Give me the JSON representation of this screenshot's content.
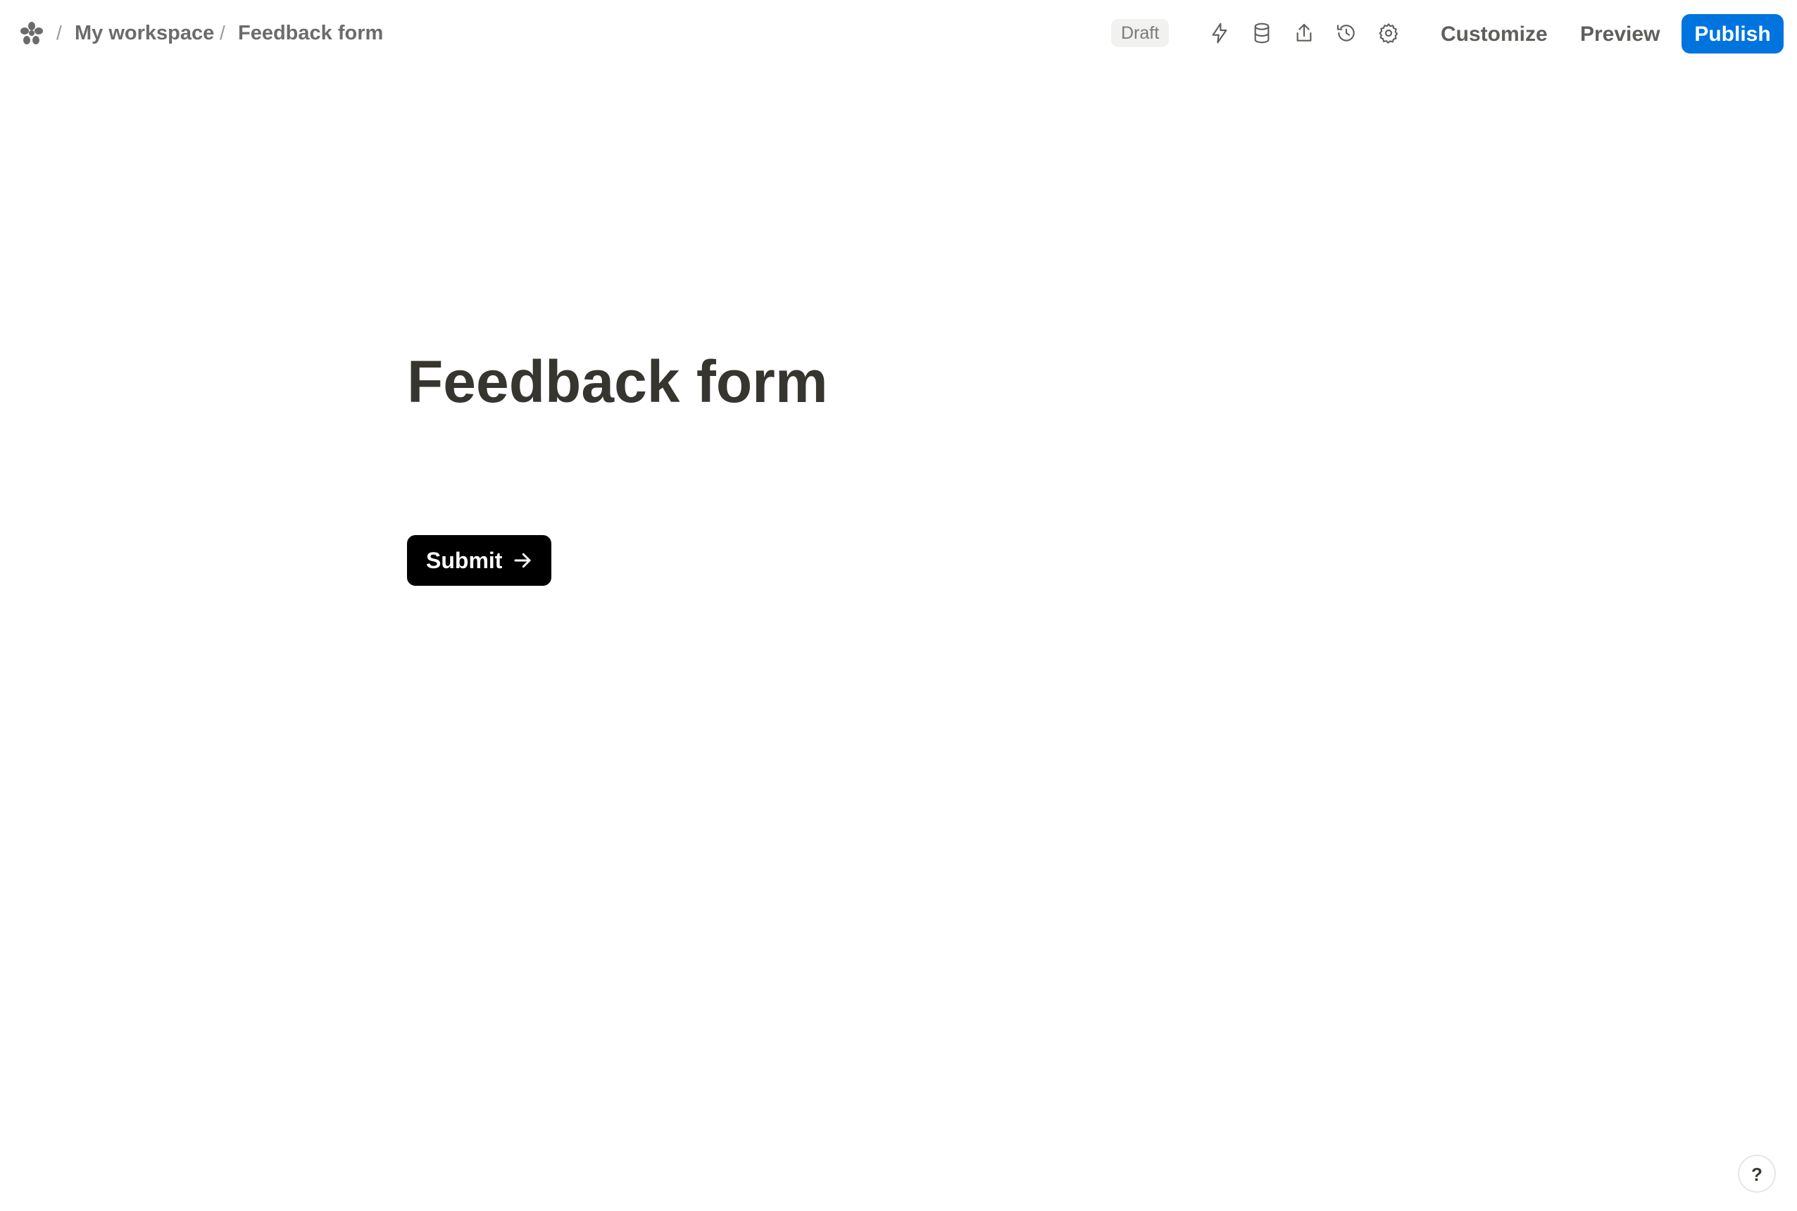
{
  "header": {
    "breadcrumb": [
      {
        "label": "My workspace"
      },
      {
        "label": "Feedback form"
      }
    ],
    "separator": "/",
    "status_badge": "Draft",
    "icons": [
      "lightning-icon",
      "database-icon",
      "share-icon",
      "history-icon",
      "gear-icon"
    ],
    "customize_label": "Customize",
    "preview_label": "Preview",
    "publish_label": "Publish"
  },
  "form": {
    "title": "Feedback form",
    "submit_label": "Submit"
  },
  "help": {
    "label": "?"
  },
  "colors": {
    "accent": "#0074de",
    "submit_bg": "#000000",
    "text": "#37352f"
  }
}
